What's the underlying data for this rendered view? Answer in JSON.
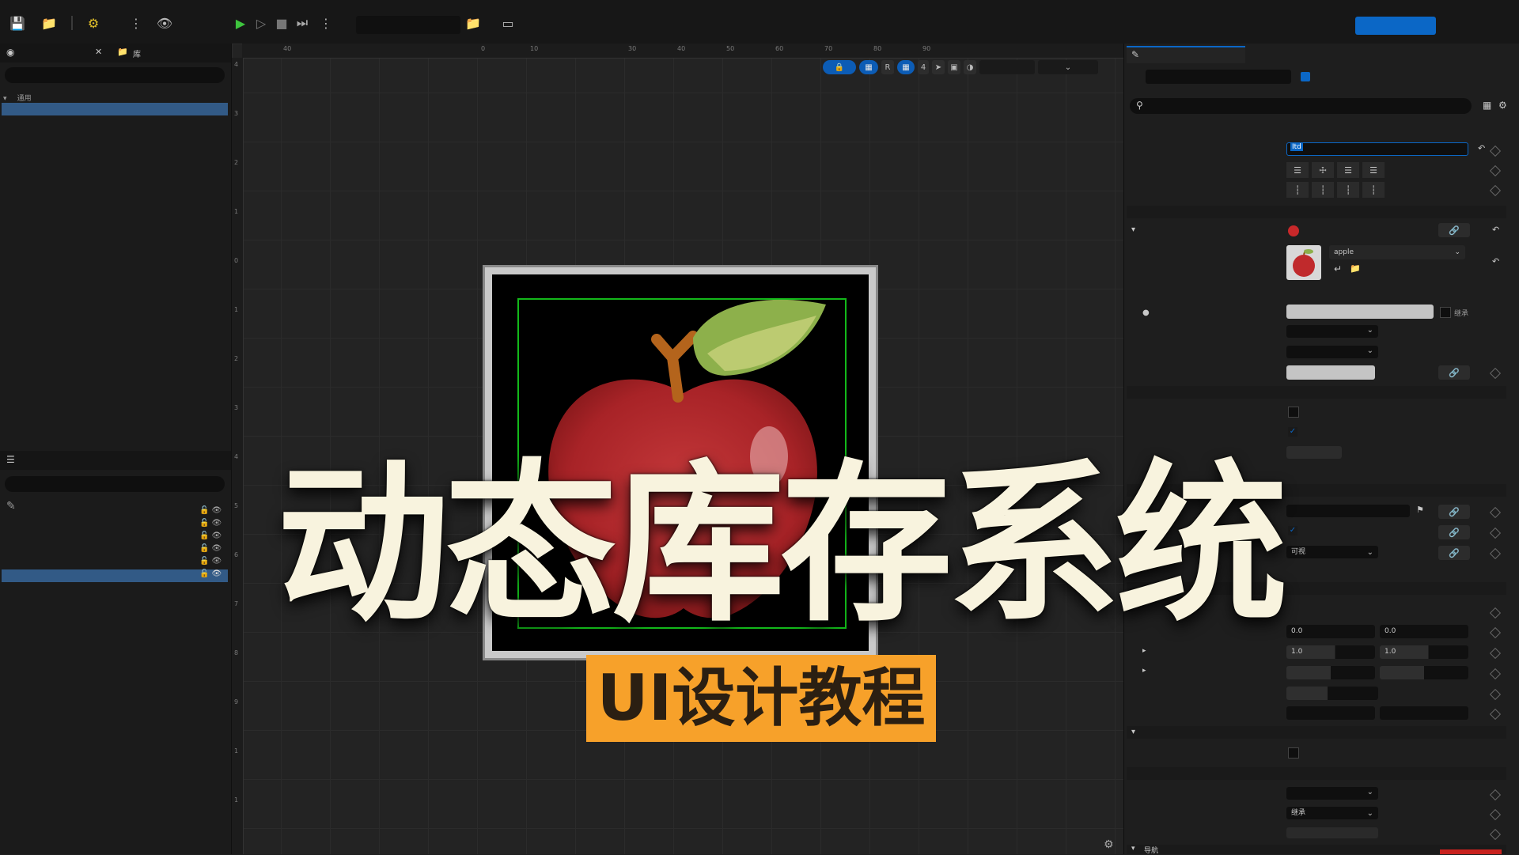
{
  "thumbnail": {
    "title": "动态库存系统",
    "subtitle": "UI设计教程"
  },
  "left_panel": {
    "library_tab": "库",
    "category_label": "通用"
  },
  "canvas": {
    "ruler_top": [
      "40",
      "0",
      "10",
      "30",
      "40",
      "50",
      "60",
      "70",
      "80",
      "90"
    ],
    "ruler_left": [
      "4",
      "3",
      "2",
      "1",
      "0",
      "1",
      "2",
      "3",
      "4",
      "5",
      "6",
      "7",
      "8",
      "9",
      "1",
      "1"
    ],
    "toolbar": {
      "r_label": "R",
      "grid_value": "4"
    }
  },
  "details_panel": {
    "name_value": "Itd",
    "image_name": "apple",
    "inherit_label": "继承",
    "visibility_value": "可视",
    "transform": {
      "translation": [
        "0.0",
        "0.0"
      ],
      "scale": [
        "1.0",
        "1.0"
      ]
    },
    "dropdown_bottom": "继承",
    "section_bottom": "导航"
  },
  "colors": {
    "accent_blue": "#0b67c6",
    "selection": "#325a86",
    "title_text": "#f8f3de",
    "subtitle_bg": "#f7a12a",
    "subtitle_text": "#2b1f12",
    "apple_red": "#b8282a",
    "leaf_green": "#8db04b"
  }
}
